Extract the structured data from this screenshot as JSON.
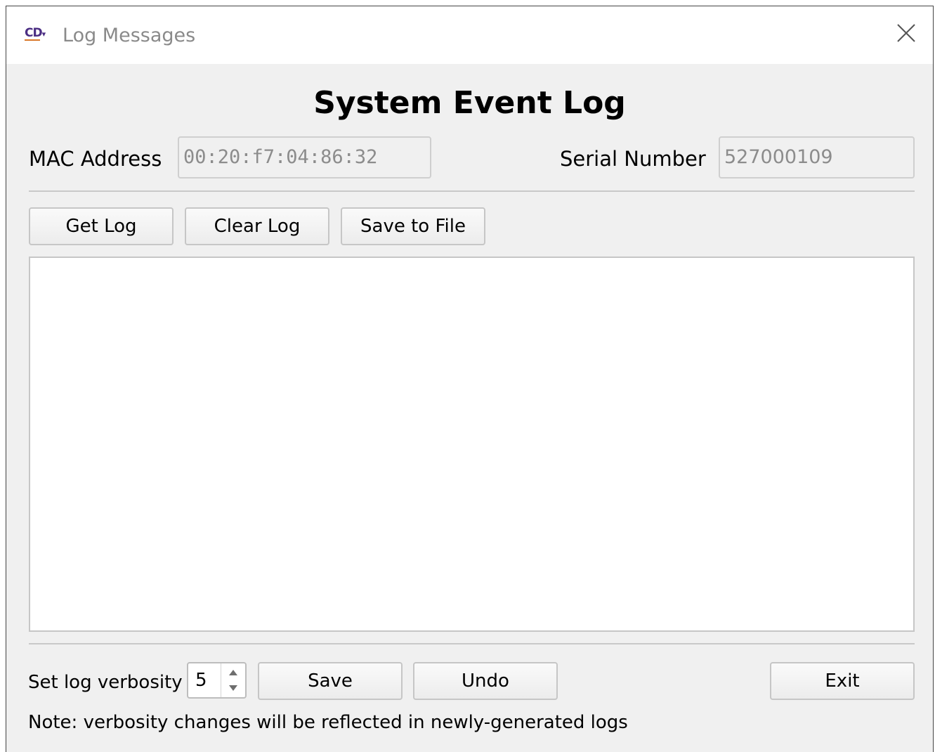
{
  "window": {
    "title": "Log Messages",
    "app_icon_text": "CD"
  },
  "header": {
    "title": "System Event Log"
  },
  "device": {
    "mac_label": "MAC Address",
    "mac_value": "00:20:f7:04:86:32",
    "serial_label": "Serial Number",
    "serial_value": "527000109"
  },
  "toolbar": {
    "get_log_label": "Get Log",
    "clear_log_label": "Clear Log",
    "save_to_file_label": "Save to File"
  },
  "log": {
    "text": ""
  },
  "verbosity": {
    "label": "Set log verbosity",
    "value": "5",
    "save_label": "Save",
    "undo_label": "Undo",
    "note": "Note: verbosity changes will be reflected in newly-generated logs"
  },
  "footer": {
    "exit_label": "Exit"
  },
  "icons": {
    "close": "close-icon",
    "app": "cd-app-icon",
    "spin_up": "chevron-up-icon",
    "spin_down": "chevron-down-icon"
  },
  "colors": {
    "window_bg": "#f0f0f0",
    "titlebar_bg": "#ffffff",
    "readonly_text": "#8c8c8c",
    "app_icon": "#4b2e83"
  }
}
